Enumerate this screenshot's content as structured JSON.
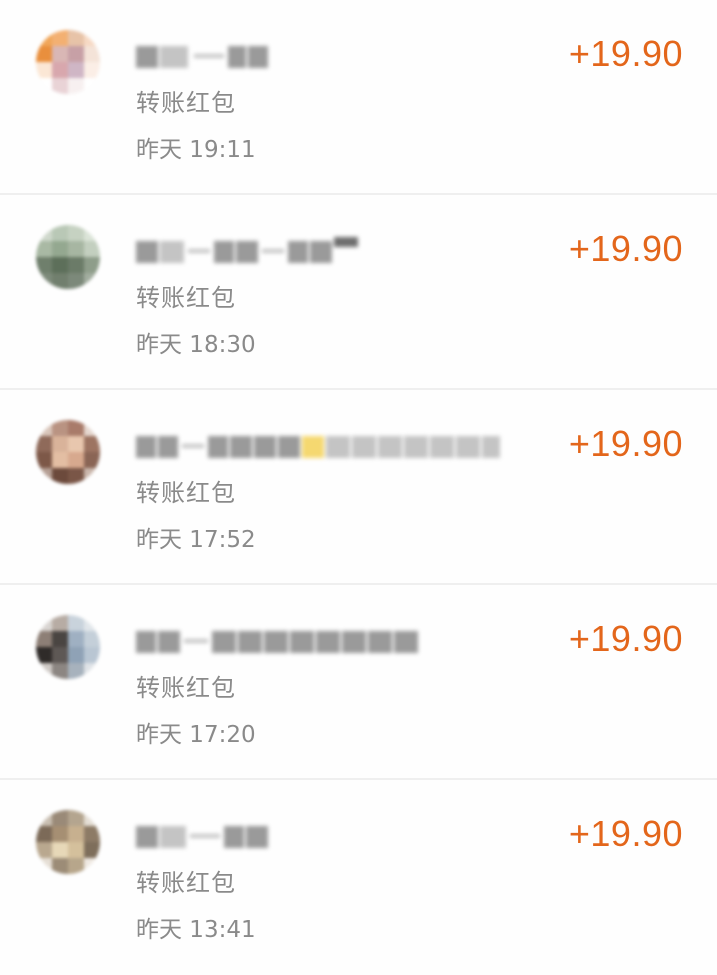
{
  "transactions": [
    {
      "type": "转账红包",
      "time": "昨天 19:11",
      "amount": "+19.90",
      "avatar_colors": [
        "#f0a65a",
        "#f3b072",
        "#e7c3a8",
        "#f6d9c4",
        "#e98f3d",
        "#d9b7b5",
        "#c7a0a6",
        "#f4e3d8",
        "#fbe7d5",
        "#d8a7ad",
        "#cfb6c5",
        "#fbeee6",
        "#ffffff",
        "#e9d3d6",
        "#f7f0f0",
        "#ffffff"
      ]
    },
    {
      "type": "转账红包",
      "time": "昨天 18:30",
      "amount": "+19.90",
      "avatar_colors": [
        "#cfd8cc",
        "#b9c8b6",
        "#c6d2c2",
        "#dbe4d8",
        "#a9b9a4",
        "#94a890",
        "#a7b6a2",
        "#c3cfbf",
        "#6f7f6c",
        "#5d6f5a",
        "#6b7b68",
        "#8e9d8a",
        "#7d8a7a",
        "#717f6e",
        "#7c897a",
        "#a2ad9f"
      ]
    },
    {
      "type": "转账红包",
      "time": "昨天 17:52",
      "amount": "+19.90",
      "avatar_colors": [
        "#d9c6bb",
        "#b99382",
        "#a97b6a",
        "#e5d7cf",
        "#8f6a5a",
        "#d9b39a",
        "#e8c7ae",
        "#9d7462",
        "#7d5848",
        "#e3bea3",
        "#d7a98e",
        "#8a6555",
        "#b6a095",
        "#6c4a3c",
        "#7a5647",
        "#cab7ac"
      ]
    },
    {
      "type": "转账红包",
      "time": "昨天 17:20",
      "amount": "+19.90",
      "avatar_colors": [
        "#d9d5d2",
        "#b7aca4",
        "#c9d3dc",
        "#e1e6ea",
        "#8d7f76",
        "#4a4542",
        "#9fb0c2",
        "#c4cfd9",
        "#2f2b29",
        "#5e5855",
        "#8fa2b6",
        "#b9c6d3",
        "#cfcac6",
        "#8c8682",
        "#a7b2bd",
        "#dfe3e7"
      ]
    },
    {
      "type": "转账红包",
      "time": "昨天 13:41",
      "amount": "+19.90",
      "avatar_colors": [
        "#c9bfb2",
        "#9a8a78",
        "#b4a58f",
        "#e4ded5",
        "#7c6a58",
        "#a68f73",
        "#c7b08f",
        "#8d7b66",
        "#b9a88f",
        "#e7d8b8",
        "#d4c09c",
        "#7e6e5b",
        "#e6dfd6",
        "#9c8c77",
        "#b7a68b",
        "#efe9e2"
      ]
    }
  ]
}
